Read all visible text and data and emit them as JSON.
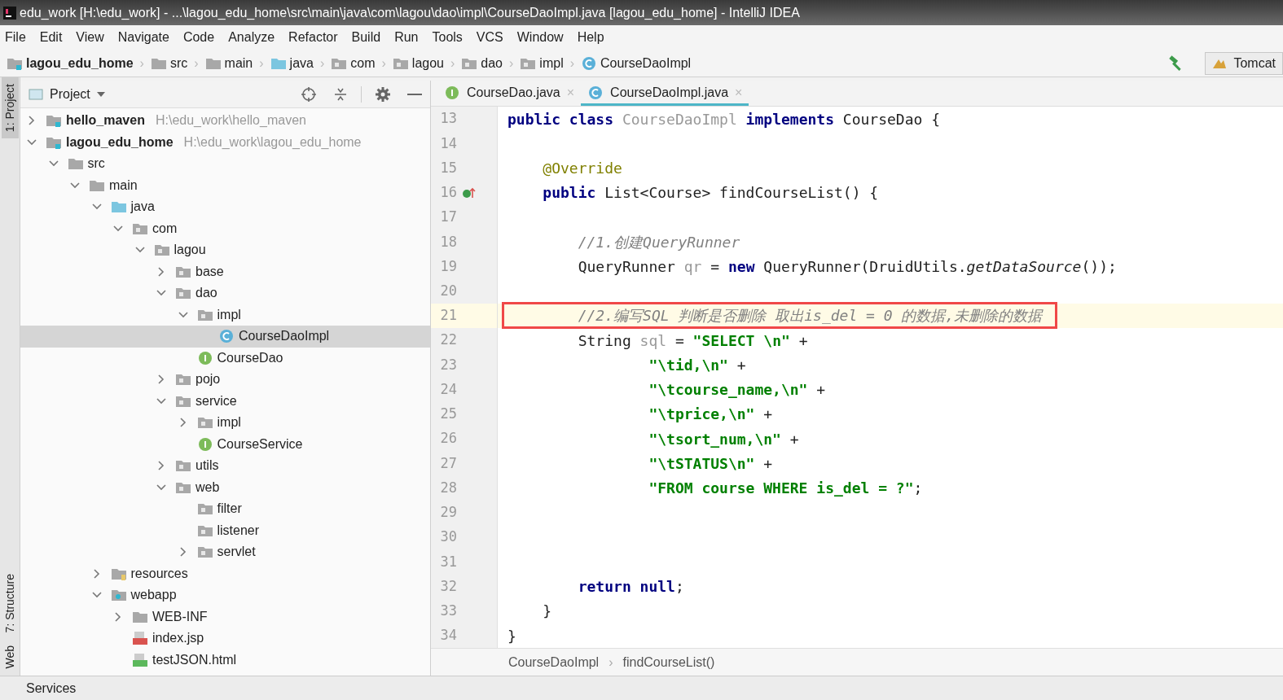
{
  "window": {
    "title": "edu_work [H:\\edu_work] - ...\\lagou_edu_home\\src\\main\\java\\com\\lagou\\dao\\impl\\CourseDaoImpl.java [lagou_edu_home] - IntelliJ IDEA"
  },
  "menu": [
    "File",
    "Edit",
    "View",
    "Navigate",
    "Code",
    "Analyze",
    "Refactor",
    "Build",
    "Run",
    "Tools",
    "VCS",
    "Window",
    "Help"
  ],
  "breadcrumbs": [
    {
      "label": "lagou_edu_home",
      "kind": "module",
      "separator": "›"
    },
    {
      "label": "src",
      "kind": "folder",
      "separator": "›"
    },
    {
      "label": "main",
      "kind": "folder",
      "separator": "›"
    },
    {
      "label": "java",
      "kind": "source",
      "separator": "›"
    },
    {
      "label": "com",
      "kind": "package",
      "separator": "›"
    },
    {
      "label": "lagou",
      "kind": "package",
      "separator": "›"
    },
    {
      "label": "dao",
      "kind": "package",
      "separator": "›"
    },
    {
      "label": "impl",
      "kind": "package",
      "separator": "›"
    },
    {
      "label": "CourseDaoImpl",
      "kind": "class"
    }
  ],
  "run_config": {
    "label": "Tomcat"
  },
  "tool_stripe": [
    {
      "label": "1: Project",
      "selected": true
    },
    {
      "label": "7: Structure",
      "selected": false
    },
    {
      "label": "Web",
      "selected": false
    }
  ],
  "project_panel": {
    "title": "Project",
    "tree": [
      {
        "label": "hello_maven",
        "kind": "module",
        "path": "H:\\edu_work\\hello_maven",
        "expanded": false,
        "selected": false
      },
      {
        "label": "lagou_edu_home",
        "kind": "module",
        "path": "H:\\edu_work\\lagou_edu_home",
        "expanded": true,
        "selected": false,
        "children": [
          {
            "label": "src",
            "kind": "folder",
            "expanded": true,
            "selected": false,
            "children": [
              {
                "label": "main",
                "kind": "folder",
                "expanded": true,
                "selected": false,
                "children": [
                  {
                    "label": "java",
                    "kind": "source",
                    "expanded": true,
                    "selected": false,
                    "children": [
                      {
                        "label": "com",
                        "kind": "package",
                        "expanded": true,
                        "selected": false,
                        "children": [
                          {
                            "label": "lagou",
                            "kind": "package",
                            "expanded": true,
                            "selected": false,
                            "children": [
                              {
                                "label": "base",
                                "kind": "package",
                                "expanded": false,
                                "selected": false
                              },
                              {
                                "label": "dao",
                                "kind": "package",
                                "expanded": true,
                                "selected": false,
                                "children": [
                                  {
                                    "label": "impl",
                                    "kind": "package",
                                    "expanded": true,
                                    "selected": false,
                                    "children": [
                                      {
                                        "label": "CourseDaoImpl",
                                        "kind": "class",
                                        "selected": true
                                      }
                                    ]
                                  },
                                  {
                                    "label": "CourseDao",
                                    "kind": "interface",
                                    "selected": false
                                  }
                                ]
                              },
                              {
                                "label": "pojo",
                                "kind": "package",
                                "expanded": false,
                                "selected": false
                              },
                              {
                                "label": "service",
                                "kind": "package",
                                "expanded": true,
                                "selected": false,
                                "children": [
                                  {
                                    "label": "impl",
                                    "kind": "package",
                                    "expanded": false,
                                    "selected": false
                                  },
                                  {
                                    "label": "CourseService",
                                    "kind": "interface",
                                    "selected": false
                                  }
                                ]
                              },
                              {
                                "label": "utils",
                                "kind": "package",
                                "expanded": false,
                                "selected": false
                              },
                              {
                                "label": "web",
                                "kind": "package",
                                "expanded": true,
                                "selected": false,
                                "children": [
                                  {
                                    "label": "filter",
                                    "kind": "package",
                                    "selected": false
                                  },
                                  {
                                    "label": "listener",
                                    "kind": "package",
                                    "selected": false
                                  },
                                  {
                                    "label": "servlet",
                                    "kind": "package",
                                    "expanded": false,
                                    "selected": false
                                  }
                                ]
                              }
                            ]
                          }
                        ]
                      }
                    ]
                  },
                  {
                    "label": "resources",
                    "kind": "resources",
                    "expanded": false,
                    "selected": false
                  },
                  {
                    "label": "webapp",
                    "kind": "webapp",
                    "expanded": true,
                    "selected": false,
                    "children": [
                      {
                        "label": "WEB-INF",
                        "kind": "folder",
                        "expanded": false,
                        "selected": false
                      },
                      {
                        "label": "index.jsp",
                        "kind": "jsp",
                        "selected": false
                      },
                      {
                        "label": "testJSON.html",
                        "kind": "html",
                        "selected": false
                      }
                    ]
                  }
                ]
              }
            ]
          }
        ]
      }
    ]
  },
  "editor_tabs": [
    {
      "label": "CourseDao.java",
      "kind": "interface",
      "selected": false,
      "close": "×"
    },
    {
      "label": "CourseDaoImpl.java",
      "kind": "class",
      "selected": true,
      "close": "×"
    }
  ],
  "code": [
    {
      "n": "13",
      "kind": "plain",
      "current": false,
      "tokens": [
        {
          "t": "public class ",
          "kind": "keyword"
        },
        {
          "t": "CourseDaoImpl",
          "kind": "unused"
        },
        {
          "t": " implements ",
          "kind": "keyword"
        },
        {
          "t": "CourseDao {",
          "kind": "plain"
        }
      ]
    },
    {
      "n": "14",
      "kind": "plain",
      "current": false
    },
    {
      "n": "15",
      "kind": "plain",
      "current": false,
      "tokens": [
        {
          "t": "    @Override",
          "kind": "annotation"
        }
      ]
    },
    {
      "n": "16",
      "kind": "override",
      "current": false,
      "tokens": [
        {
          "t": "    public ",
          "kind": "keyword"
        },
        {
          "t": "List<Course> findCourseList() {",
          "kind": "plain"
        }
      ]
    },
    {
      "n": "17",
      "kind": "plain",
      "current": false
    },
    {
      "n": "18",
      "kind": "plain",
      "current": false,
      "tokens": [
        {
          "t": "        //1.创建QueryRunner",
          "kind": "comment"
        }
      ]
    },
    {
      "n": "19",
      "kind": "plain",
      "current": false,
      "tokens": [
        {
          "t": "        QueryRunner ",
          "kind": "plain"
        },
        {
          "t": "qr",
          "kind": "unused"
        },
        {
          "t": " = ",
          "kind": "plain"
        },
        {
          "t": "new ",
          "kind": "keyword"
        },
        {
          "t": "QueryRunner(DruidUtils.",
          "kind": "plain"
        },
        {
          "t": "getDataSource",
          "kind": "static"
        },
        {
          "t": "());",
          "kind": "plain"
        }
      ]
    },
    {
      "n": "20",
      "kind": "plain",
      "current": false
    },
    {
      "n": "21",
      "kind": "plain",
      "current": true,
      "boxed": true,
      "tokens": [
        {
          "t": "        //2.编写SQL 判断是否删除 取出is_del = 0 的数据,未删除的数据",
          "kind": "comment"
        }
      ]
    },
    {
      "n": "22",
      "kind": "plain",
      "current": false,
      "tokens": [
        {
          "t": "        String ",
          "kind": "plain"
        },
        {
          "t": "sql",
          "kind": "unused"
        },
        {
          "t": " = ",
          "kind": "plain"
        },
        {
          "t": "\"SELECT \\n\"",
          "kind": "string"
        },
        {
          "t": " +",
          "kind": "plain"
        }
      ]
    },
    {
      "n": "23",
      "kind": "plain",
      "current": false,
      "tokens": [
        {
          "t": "                \"\\tid,\\n\"",
          "kind": "string"
        },
        {
          "t": " +",
          "kind": "plain"
        }
      ]
    },
    {
      "n": "24",
      "kind": "plain",
      "current": false,
      "tokens": [
        {
          "t": "                \"\\tcourse_name,\\n\"",
          "kind": "string"
        },
        {
          "t": " +",
          "kind": "plain"
        }
      ]
    },
    {
      "n": "25",
      "kind": "plain",
      "current": false,
      "tokens": [
        {
          "t": "                \"\\tprice,\\n\"",
          "kind": "string"
        },
        {
          "t": " +",
          "kind": "plain"
        }
      ]
    },
    {
      "n": "26",
      "kind": "plain",
      "current": false,
      "tokens": [
        {
          "t": "                \"\\tsort_num,\\n\"",
          "kind": "string"
        },
        {
          "t": " +",
          "kind": "plain"
        }
      ]
    },
    {
      "n": "27",
      "kind": "plain",
      "current": false,
      "tokens": [
        {
          "t": "                \"\\tSTATUS\\n\"",
          "kind": "string"
        },
        {
          "t": " +",
          "kind": "plain"
        }
      ]
    },
    {
      "n": "28",
      "kind": "plain",
      "current": false,
      "tokens": [
        {
          "t": "                \"FROM course WHERE is_del = ?\"",
          "kind": "string"
        },
        {
          "t": ";",
          "kind": "plain"
        }
      ]
    },
    {
      "n": "29",
      "kind": "plain",
      "current": false
    },
    {
      "n": "30",
      "kind": "plain",
      "current": false
    },
    {
      "n": "31",
      "kind": "plain",
      "current": false
    },
    {
      "n": "32",
      "kind": "plain",
      "current": false,
      "tokens": [
        {
          "t": "        return null",
          "kind": "keyword"
        },
        {
          "t": ";",
          "kind": "plain"
        }
      ]
    },
    {
      "n": "33",
      "kind": "plain",
      "current": false,
      "tokens": [
        {
          "t": "    }",
          "kind": "plain"
        }
      ]
    },
    {
      "n": "34",
      "kind": "plain",
      "current": false,
      "tokens": [
        {
          "t": "}",
          "kind": "plain"
        }
      ]
    }
  ],
  "editor_breadcrumbs": [
    {
      "label": "CourseDaoImpl",
      "separator": "›"
    },
    {
      "label": "findCourseList()"
    }
  ],
  "bottom_bar": {
    "label": "Services"
  }
}
